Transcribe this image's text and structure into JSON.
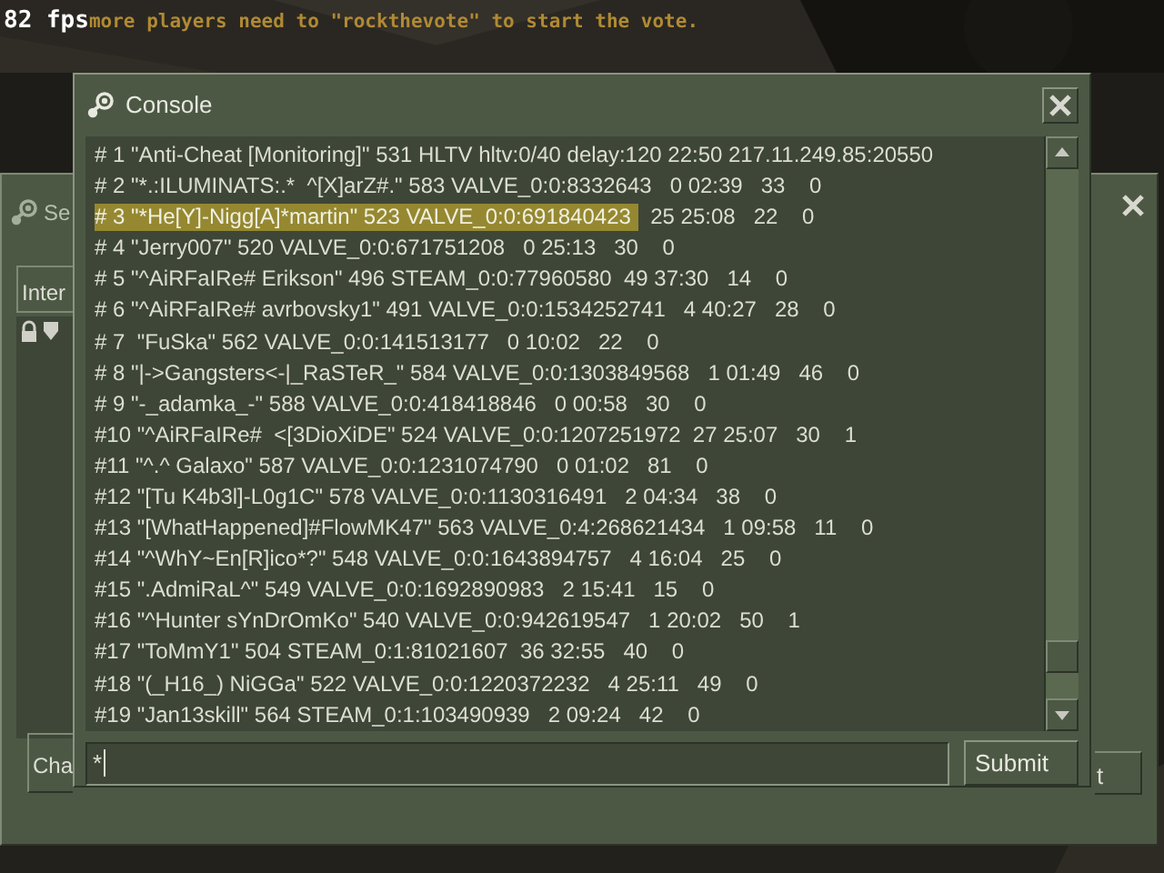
{
  "hud": {
    "fps": "82 fps",
    "message": "more players need to \"rockthevote\" to start the vote."
  },
  "back_window": {
    "title": "Se",
    "tab": "Inter",
    "button_left": "Cha",
    "button_right": "t"
  },
  "console": {
    "title": "Console",
    "lines": [
      {
        "text": "# 1 \"Anti-Cheat [Monitoring]\" 531 HLTV hltv:0/40 delay:120 22:50 217.11.249.85:20550",
        "selected": false
      },
      {
        "text": "# 2 \"*.:ILUMINATS:.*  ^[X]arZ#.\" 583 VALVE_0:0:8332643   0 02:39   33    0",
        "selected": false
      },
      {
        "text": "# 3 \"*He[Y]-Nigg[A]*martin\" 523 VALVE_0:0:691840423",
        "tail": "  25 25:08   22    0",
        "selected": true
      },
      {
        "text": "# 4 \"Jerry007\" 520 VALVE_0:0:671751208   0 25:13   30    0",
        "selected": false
      },
      {
        "text": "# 5 \"^AiRFaIRe# Erikson\" 496 STEAM_0:0:77960580  49 37:30   14    0",
        "selected": false
      },
      {
        "text": "# 6 \"^AiRFaIRe# avrbovsky1\" 491 VALVE_0:0:1534252741   4 40:27   28    0",
        "selected": false
      },
      {
        "text": "# 7  \"FuSka\" 562 VALVE_0:0:141513177   0 10:02   22    0",
        "selected": false
      },
      {
        "text": "# 8 \"|->Gangsters<-|_RaSTeR_\" 584 VALVE_0:0:1303849568   1 01:49   46    0",
        "selected": false
      },
      {
        "text": "# 9 \"-_adamka_-\" 588 VALVE_0:0:418418846   0 00:58   30    0",
        "selected": false
      },
      {
        "text": "#10 \"^AiRFaIRe#  <[3DioXiDE\" 524 VALVE_0:0:1207251972  27 25:07   30    1",
        "selected": false
      },
      {
        "text": "#11 \"^.^ Galaxo\" 587 VALVE_0:0:1231074790   0 01:02   81    0",
        "selected": false
      },
      {
        "text": "#12 \"[Tu K4b3l]-L0g1C\" 578 VALVE_0:0:1130316491   2 04:34   38    0",
        "selected": false
      },
      {
        "text": "#13 \"[WhatHappened]#FlowMK47\" 563 VALVE_0:4:268621434   1 09:58   11    0",
        "selected": false
      },
      {
        "text": "#14 \"^WhY~En[R]ico*?\" 548 VALVE_0:0:1643894757   4 16:04   25    0",
        "selected": false
      },
      {
        "text": "#15 \".AdmiRaL^\" 549 VALVE_0:0:1692890983   2 15:41   15    0",
        "selected": false
      },
      {
        "text": "#16 \"^Hunter sYnDrOmKo\" 540 VALVE_0:0:942619547   1 20:02   50    1",
        "selected": false
      },
      {
        "text": "#17 \"ToMmY1\" 504 STEAM_0:1:81021607  36 32:55   40    0",
        "selected": false
      },
      {
        "text": "#18 \"(_H16_) NiGGa\" 522 VALVE_0:0:1220372232   4 25:11   49    0",
        "selected": false
      },
      {
        "text": "#19 \"Jan13skill\" 564 STEAM_0:1:103490939   2 09:24   42    0",
        "selected": false
      }
    ],
    "input_value": "*",
    "submit": "Submit"
  }
}
